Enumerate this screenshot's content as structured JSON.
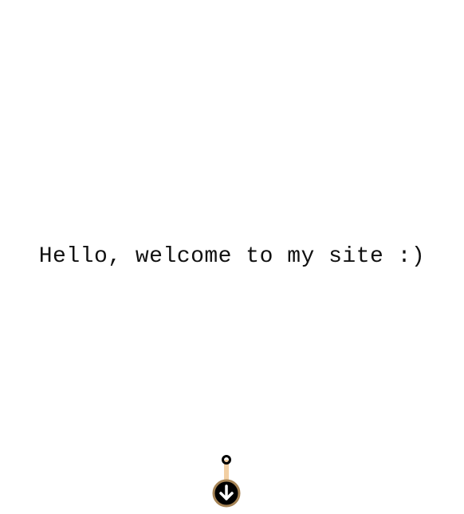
{
  "main": {
    "welcome_text": "Hello, welcome to my site :)"
  },
  "scroll_indicator": {
    "icon": "arrow-down-circle-icon",
    "knob_icon": "ring-icon",
    "stem_color": "#f2cfa3",
    "circle_color": "#000000",
    "circle_border_color": "#a58355",
    "arrow_color": "#ffffff"
  }
}
